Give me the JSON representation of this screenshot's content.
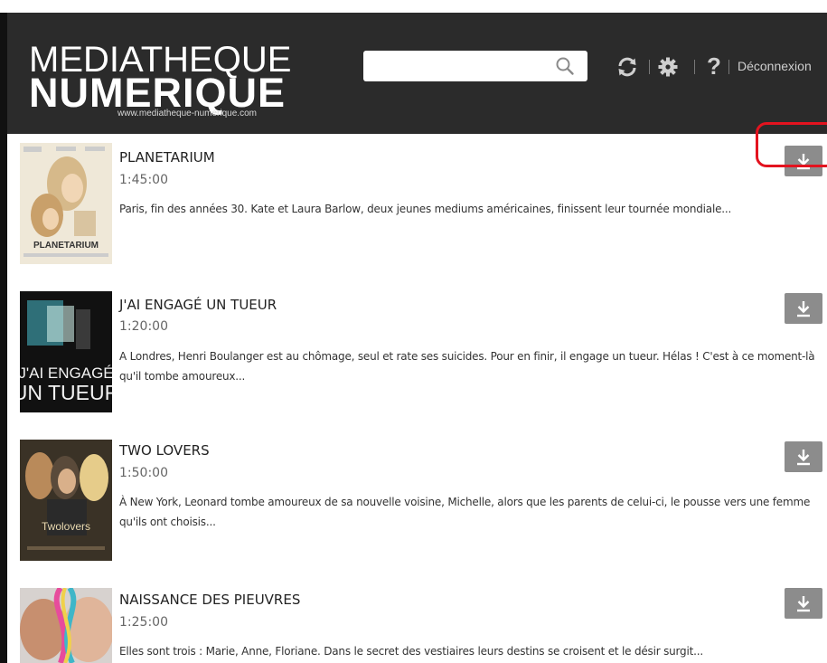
{
  "header": {
    "logo_line1": "MEDIATHEQUE",
    "logo_line2": "NUMERIQUE",
    "logo_url": "www.mediatheque-numerique.com",
    "search_placeholder": "",
    "logout_label": "Déconnexion",
    "help_label": "?",
    "icons": [
      "search-icon",
      "refresh-icon",
      "gear-icon",
      "help-icon"
    ]
  },
  "colors": {
    "header_bg": "#2b2b2b",
    "download_button_bg": "#8c8c8c",
    "highlight_border": "#e3131f"
  },
  "films": [
    {
      "title": "PLANETARIUM",
      "duration": "1:45:00",
      "synopsis": "Paris, fin des années 30. Kate et Laura Barlow, deux jeunes mediums américaines, finissent leur tournée mondiale...",
      "poster_text": "PLANETARIUM"
    },
    {
      "title": "J'AI ENGAGÉ UN TUEUR",
      "duration": "1:20:00",
      "synopsis": "A Londres, Henri Boulanger est au chômage, seul et rate ses suicides. Pour en finir, il engage un tueur. Hélas ! C'est à ce moment-là qu'il tombe amoureux...",
      "poster_text_1": "J'AI ENGAGÉ",
      "poster_text_2": "UN TUEUR"
    },
    {
      "title": "TWO LOVERS",
      "duration": "1:50:00",
      "synopsis": "À New York, Leonard tombe amoureux de sa nouvelle voisine, Michelle, alors que les parents de celui-ci, le pousse vers une femme qu'ils ont choisis...",
      "poster_text": "Twolovers"
    },
    {
      "title": "NAISSANCE DES PIEUVRES",
      "duration": "1:25:00",
      "synopsis": "Elles sont trois : Marie, Anne, Floriane. Dans le secret des vestiaires leurs destins se croisent et le désir surgit..."
    }
  ]
}
